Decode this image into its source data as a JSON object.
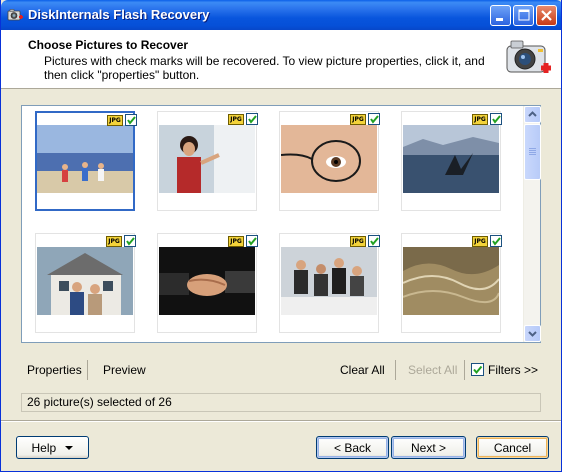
{
  "window": {
    "title": "DiskInternals Flash Recovery"
  },
  "header": {
    "title": "Choose Pictures to Recover",
    "description": "Pictures with check marks will be recovered. To view picture properties, click it, and then click \"properties\" button."
  },
  "thumbnails": [
    {
      "type": "JPG",
      "checked": true,
      "selected": true,
      "subject": "beach-children"
    },
    {
      "type": "JPG",
      "checked": true,
      "selected": false,
      "subject": "teacher-whiteboard"
    },
    {
      "type": "JPG",
      "checked": true,
      "selected": false,
      "subject": "eyeglasses-closeup"
    },
    {
      "type": "JPG",
      "checked": true,
      "selected": false,
      "subject": "whale-tail"
    },
    {
      "type": "JPG",
      "checked": true,
      "selected": false,
      "subject": "couple-house"
    },
    {
      "type": "JPG",
      "checked": true,
      "selected": false,
      "subject": "handshake"
    },
    {
      "type": "JPG",
      "checked": true,
      "selected": false,
      "subject": "business-meeting"
    },
    {
      "type": "JPG",
      "checked": true,
      "selected": false,
      "subject": "water-wave"
    }
  ],
  "toolbar": {
    "properties": "Properties",
    "preview": "Preview",
    "clear_all": "Clear All",
    "select_all": "Select All",
    "filters": "Filters >>",
    "filters_checked": true
  },
  "status": {
    "text": "26 picture(s) selected of 26"
  },
  "buttons": {
    "help": "Help",
    "back": "< Back",
    "next": "Next >",
    "cancel": "Cancel"
  }
}
